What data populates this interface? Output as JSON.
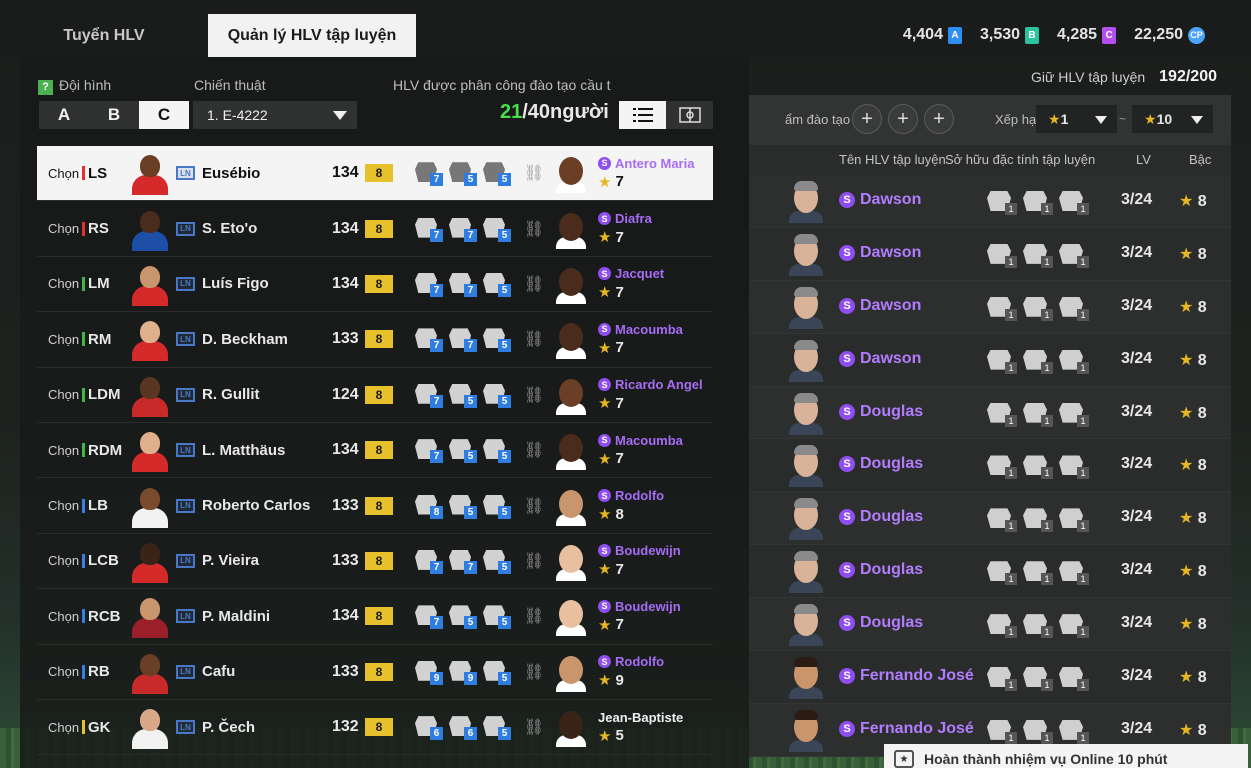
{
  "tabs": [
    {
      "label": "Tuyển HLV"
    },
    {
      "label": "Quản lý HLV tập luyện"
    }
  ],
  "currencies": [
    {
      "value": "4,404",
      "badge": "A",
      "color": "#2f8ef5"
    },
    {
      "value": "3,530",
      "badge": "B",
      "color": "#2cc4a0"
    },
    {
      "value": "4,285",
      "badge": "C",
      "color": "#b44ef2"
    },
    {
      "value": "22,250",
      "badge": "CP",
      "color": "#4aa3ff"
    }
  ],
  "left": {
    "help": "?",
    "formation_label": "Đội hình",
    "formations": [
      "A",
      "B",
      "C"
    ],
    "tactic_label": "Chiến thuật",
    "tactic_value": "1. E-4222",
    "assign_label": "HLV được phân công đào tạo cầu t",
    "count_current": "21",
    "count_total": "/40người",
    "players": [
      {
        "chon": "Chọn",
        "pos": "LS",
        "bar": "#e63030",
        "name": "Eusébio",
        "ovr": "134",
        "grade": "8",
        "kit": "#d42a2a",
        "skin": "#6b3f25",
        "skills": [
          "7",
          "5",
          "5"
        ],
        "coach": "Antero Maria",
        "cstar": "7",
        "cskin": "#6b3f25",
        "special": true
      },
      {
        "chon": "Chọn",
        "pos": "RS",
        "bar": "#e63030",
        "name": "S. Eto'o",
        "ovr": "134",
        "grade": "8",
        "kit": "#1e4fa8",
        "skin": "#4a2c1c",
        "skills": [
          "7",
          "7",
          "5"
        ],
        "coach": "Diafra",
        "cstar": "7",
        "cskin": "#4a2c1c",
        "special": true
      },
      {
        "chon": "Chọn",
        "pos": "LM",
        "bar": "#3fb54a",
        "name": "Luís Figo",
        "ovr": "134",
        "grade": "8",
        "kit": "#d42a2a",
        "skin": "#c9956c",
        "skills": [
          "7",
          "7",
          "5"
        ],
        "coach": "Jacquet",
        "cstar": "7",
        "cskin": "#4a2c1c",
        "special": true
      },
      {
        "chon": "Chọn",
        "pos": "RM",
        "bar": "#3fb54a",
        "name": "D. Beckham",
        "ovr": "133",
        "grade": "8",
        "kit": "#d42a2a",
        "skin": "#e0b08c",
        "skills": [
          "7",
          "7",
          "5"
        ],
        "coach": "Macoumba",
        "cstar": "7",
        "cskin": "#4a2c1c",
        "special": true
      },
      {
        "chon": "Chọn",
        "pos": "LDM",
        "bar": "#3fb54a",
        "name": "R. Gullit",
        "ovr": "124",
        "grade": "8",
        "kit": "#c82a2a",
        "skin": "#5a3622",
        "skills": [
          "7",
          "5",
          "5"
        ],
        "coach": "Ricardo Angel",
        "cstar": "7",
        "cskin": "#6b3f25",
        "special": true
      },
      {
        "chon": "Chọn",
        "pos": "RDM",
        "bar": "#3fb54a",
        "name": "L. Matthäus",
        "ovr": "134",
        "grade": "8",
        "kit": "#d42a2a",
        "skin": "#e0b08c",
        "skills": [
          "7",
          "5",
          "5"
        ],
        "coach": "Macoumba",
        "cstar": "7",
        "cskin": "#4a2c1c",
        "special": true
      },
      {
        "chon": "Chọn",
        "pos": "LB",
        "bar": "#3b7de6",
        "name": "Roberto Carlos",
        "ovr": "133",
        "grade": "8",
        "kit": "#f2f2f2",
        "skin": "#7a4a2c",
        "skills": [
          "8",
          "5",
          "5"
        ],
        "coach": "Rodolfo",
        "cstar": "8",
        "cskin": "#c9956c",
        "special": true
      },
      {
        "chon": "Chọn",
        "pos": "LCB",
        "bar": "#3b7de6",
        "name": "P. Vieira",
        "ovr": "133",
        "grade": "8",
        "kit": "#d42a2a",
        "skin": "#3a2418",
        "skills": [
          "7",
          "7",
          "5"
        ],
        "coach": "Boudewijn",
        "cstar": "7",
        "cskin": "#e8c0a0",
        "special": true
      },
      {
        "chon": "Chọn",
        "pos": "RCB",
        "bar": "#3b7de6",
        "name": "P. Maldini",
        "ovr": "134",
        "grade": "8",
        "kit": "#9a1f2a",
        "skin": "#c9956c",
        "skills": [
          "7",
          "5",
          "5"
        ],
        "coach": "Boudewijn",
        "cstar": "7",
        "cskin": "#e8c0a0",
        "special": true
      },
      {
        "chon": "Chọn",
        "pos": "RB",
        "bar": "#3b7de6",
        "name": "Cafu",
        "ovr": "133",
        "grade": "8",
        "kit": "#c82a2a",
        "skin": "#6b3f25",
        "skills": [
          "9",
          "9",
          "5"
        ],
        "coach": "Rodolfo",
        "cstar": "9",
        "cskin": "#c9956c",
        "special": true
      },
      {
        "chon": "Chọn",
        "pos": "GK",
        "bar": "#e6c12c",
        "name": "P. Čech",
        "ovr": "132",
        "grade": "8",
        "kit": "#f2f2f2",
        "skin": "#d8a888",
        "skills": [
          "6",
          "6",
          "5"
        ],
        "coach": "Jean-Baptiste",
        "cstar": "5",
        "cskin": "#3a2418",
        "special": false
      }
    ]
  },
  "right": {
    "hold_label": "Giữ HLV tập luyện",
    "hold_value": "192/200",
    "filter_label": "ẩm đào tạo",
    "rank_label": "Xếp hạ",
    "rank_from": "1",
    "rank_to": "10",
    "rank_sep": "~",
    "col_name": "Tên HLV tập luyện",
    "col_traits": "Sở hữu đặc tính tập luyện",
    "col_lv": "LV",
    "col_grade": "Bậc",
    "coaches": [
      {
        "name": "Dawson",
        "lv": "3/24",
        "grade": "8",
        "skin": "#d8b39a",
        "hair": "#8a8a8a"
      },
      {
        "name": "Dawson",
        "lv": "3/24",
        "grade": "8",
        "skin": "#d8b39a",
        "hair": "#8a8a8a"
      },
      {
        "name": "Dawson",
        "lv": "3/24",
        "grade": "8",
        "skin": "#d8b39a",
        "hair": "#8a8a8a"
      },
      {
        "name": "Dawson",
        "lv": "3/24",
        "grade": "8",
        "skin": "#d8b39a",
        "hair": "#8a8a8a"
      },
      {
        "name": "Douglas",
        "lv": "3/24",
        "grade": "8",
        "skin": "#d8b39a",
        "hair": "#8a8a8a"
      },
      {
        "name": "Douglas",
        "lv": "3/24",
        "grade": "8",
        "skin": "#d8b39a",
        "hair": "#8a8a8a"
      },
      {
        "name": "Douglas",
        "lv": "3/24",
        "grade": "8",
        "skin": "#d8b39a",
        "hair": "#8a8a8a"
      },
      {
        "name": "Douglas",
        "lv": "3/24",
        "grade": "8",
        "skin": "#d8b39a",
        "hair": "#8a8a8a"
      },
      {
        "name": "Douglas",
        "lv": "3/24",
        "grade": "8",
        "skin": "#d8b39a",
        "hair": "#8a8a8a"
      },
      {
        "name": "Fernando José",
        "lv": "3/24",
        "grade": "8",
        "skin": "#c9956c",
        "hair": "#2a1c12"
      },
      {
        "name": "Fernando José",
        "lv": "3/24",
        "grade": "8",
        "skin": "#c9956c",
        "hair": "#2a1c12"
      }
    ],
    "trait_level": "1"
  },
  "notice": "Hoàn thành nhiệm vụ Online 10 phút"
}
